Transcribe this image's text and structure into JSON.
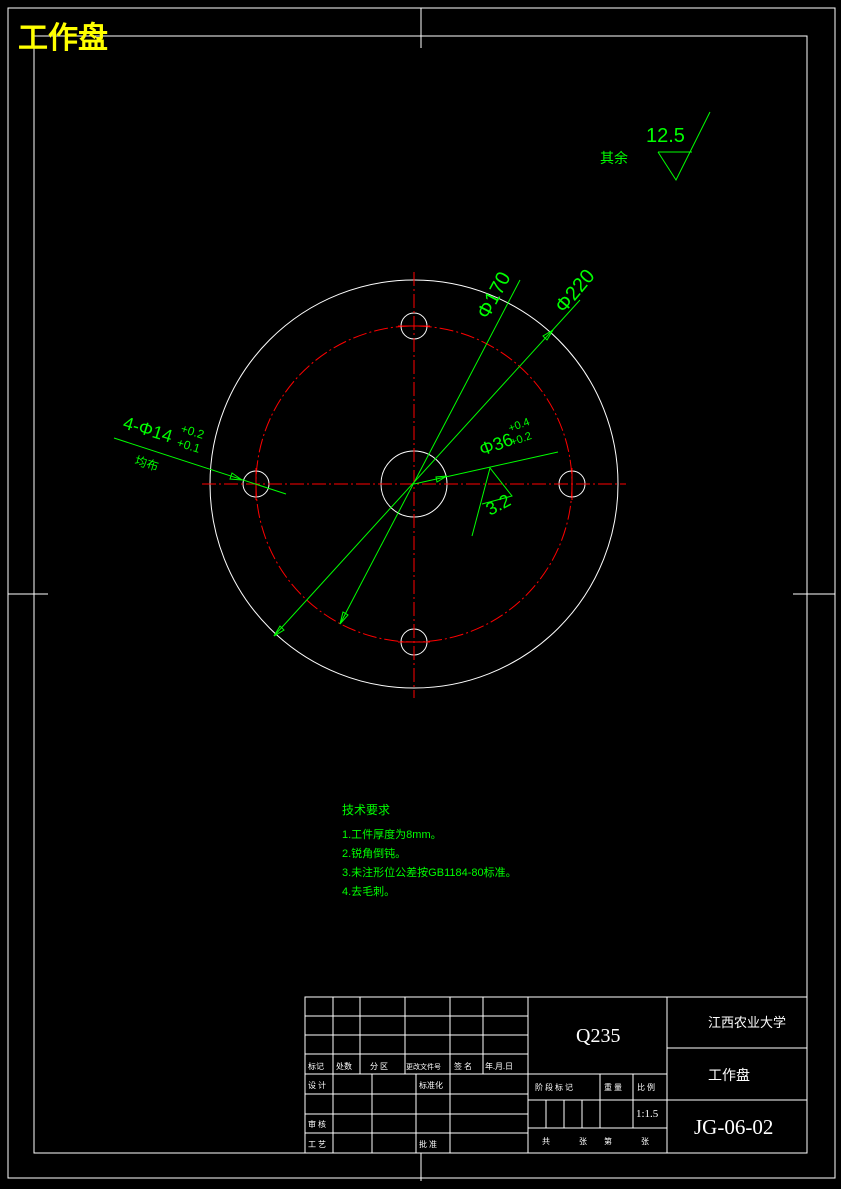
{
  "drawing_title": "工作盘",
  "roughness": {
    "prefix": "其余",
    "value": "12.5"
  },
  "dimensions": {
    "d170": "Φ170",
    "d220": "Φ220",
    "holes": "4-Φ14",
    "holes_tol_upper": "+0.2",
    "holes_tol_lower": "+0.1",
    "holes_note": "均布",
    "bore": "Φ36",
    "bore_tol_upper": "+0.4",
    "bore_tol_lower": "+0.2",
    "bore_roughness": "3.2"
  },
  "tech_requirements": {
    "heading": "技术要求",
    "items": [
      "1.工件厚度为8mm。",
      "2.锐角倒钝。",
      "3.未注形位公差按GB1184-80标准。",
      "4.去毛刺。"
    ]
  },
  "title_block": {
    "material": "Q235",
    "school": "江西农业大学",
    "part_name": "工作盘",
    "drawing_no": "JG-06-02",
    "scale": "1:1.5",
    "rev_headers": [
      "标记",
      "处数",
      "分 区",
      "更改文件号",
      "签 名",
      "年.月.日"
    ],
    "designer_label": "设 计",
    "standardize_label": "标准化",
    "review_label": "审 核",
    "process_label": "工 艺",
    "approve_label": "批 准",
    "stage_label": "阶 段 标 记",
    "weight_label": "重 量",
    "scale_label": "比 例",
    "sheets_total_label": "共",
    "sheets_label": "张",
    "sheet_no_label": "第",
    "sheet_label": "张"
  },
  "colors": {
    "outline": "#ffffff",
    "dimension": "#00ff00",
    "centerline": "#ff0000",
    "title": "#ffff00"
  }
}
